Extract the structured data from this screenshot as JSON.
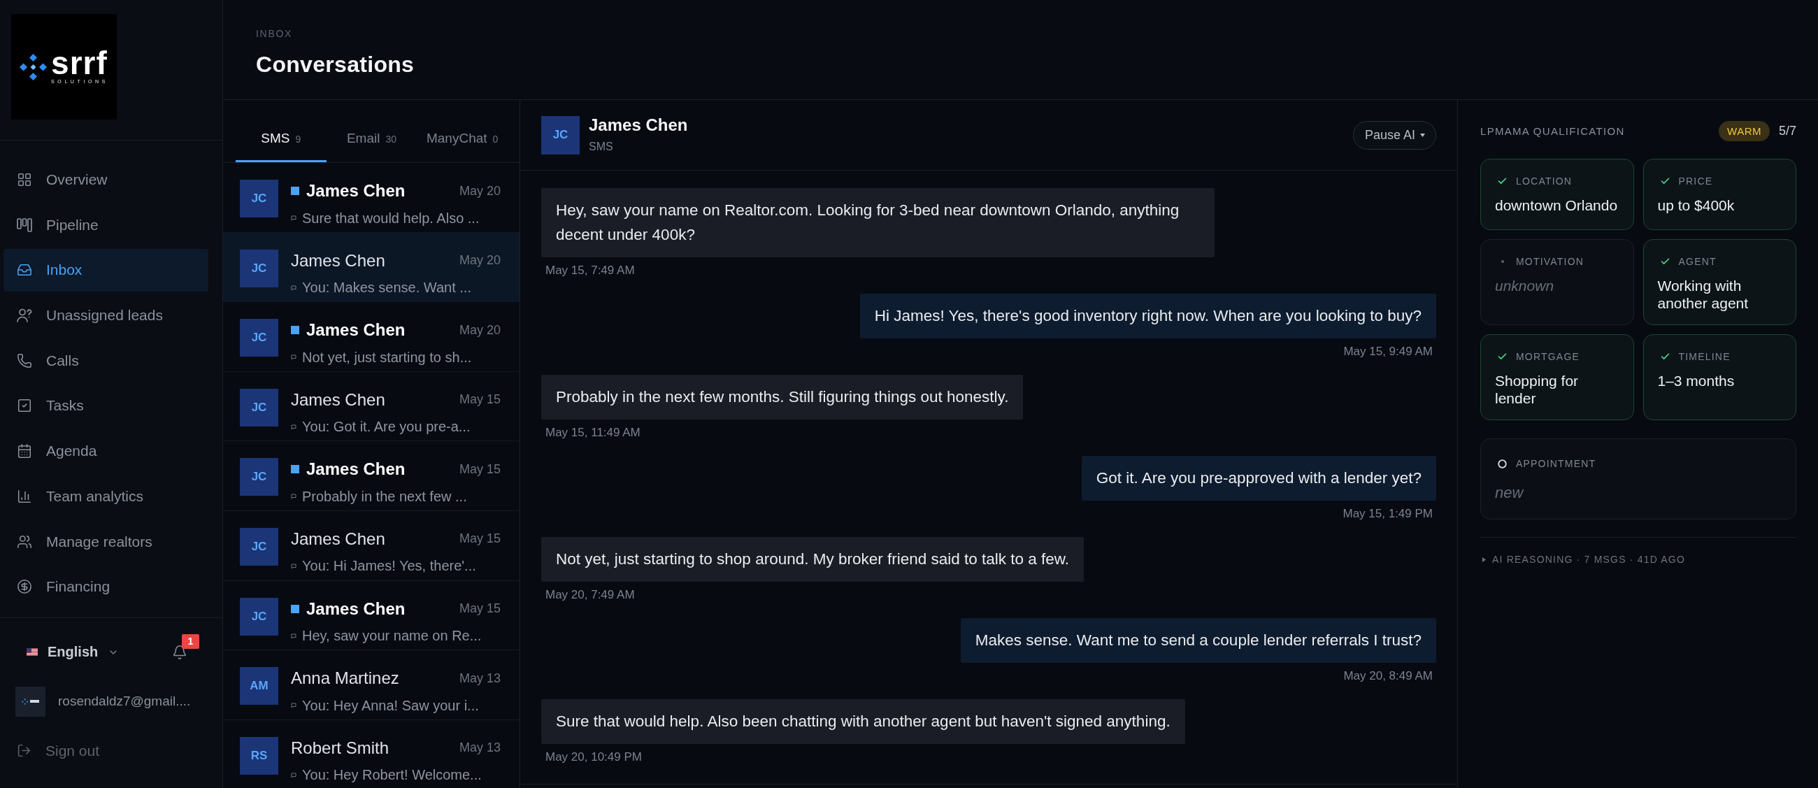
{
  "sidebar": {
    "logo": {
      "wordmark": "srrf",
      "tagline": "SOLUTIONS"
    },
    "nav": [
      {
        "label": "Overview",
        "selected": false
      },
      {
        "label": "Pipeline",
        "selected": false
      },
      {
        "label": "Inbox",
        "selected": true
      },
      {
        "label": "Unassigned leads",
        "selected": false
      },
      {
        "label": "Calls",
        "selected": false
      },
      {
        "label": "Tasks",
        "selected": false
      },
      {
        "label": "Agenda",
        "selected": false
      },
      {
        "label": "Team analytics",
        "selected": false
      },
      {
        "label": "Manage realtors",
        "selected": false
      },
      {
        "label": "Financing",
        "selected": false
      }
    ],
    "language": "English",
    "notification_count": "1",
    "user_email": "rosendaldz7@gmail....",
    "sign_out": "Sign out"
  },
  "header": {
    "eyebrow": "INBOX",
    "title": "Conversations"
  },
  "channel_tabs": [
    {
      "label": "SMS",
      "count": "9",
      "selected": true
    },
    {
      "label": "Email",
      "count": "30",
      "selected": false
    },
    {
      "label": "ManyChat",
      "count": "0",
      "selected": false
    }
  ],
  "conversations": [
    {
      "initials": "JC",
      "name": "James Chen",
      "date": "May 20",
      "preview": "Sure that would help. Also ...",
      "unread": true,
      "selected": false
    },
    {
      "initials": "JC",
      "name": "James Chen",
      "date": "May 20",
      "preview": "You: Makes sense. Want ...",
      "unread": false,
      "selected": true
    },
    {
      "initials": "JC",
      "name": "James Chen",
      "date": "May 20",
      "preview": "Not yet, just starting to sh...",
      "unread": true,
      "selected": false
    },
    {
      "initials": "JC",
      "name": "James Chen",
      "date": "May 15",
      "preview": "You: Got it. Are you pre-a...",
      "unread": false,
      "selected": false
    },
    {
      "initials": "JC",
      "name": "James Chen",
      "date": "May 15",
      "preview": "Probably in the next few ...",
      "unread": true,
      "selected": false
    },
    {
      "initials": "JC",
      "name": "James Chen",
      "date": "May 15",
      "preview": "You: Hi James! Yes, there'...",
      "unread": false,
      "selected": false
    },
    {
      "initials": "JC",
      "name": "James Chen",
      "date": "May 15",
      "preview": "Hey, saw your name on Re...",
      "unread": true,
      "selected": false
    },
    {
      "initials": "AM",
      "name": "Anna Martinez",
      "date": "May 13",
      "preview": "You: Hey Anna! Saw your i...",
      "unread": false,
      "selected": false
    },
    {
      "initials": "RS",
      "name": "Robert Smith",
      "date": "May 13",
      "preview": "You: Hey Robert! Welcome...",
      "unread": false,
      "selected": false
    }
  ],
  "chat": {
    "contact": {
      "initials": "JC",
      "name": "James Chen",
      "channel": "SMS"
    },
    "pause_button": "Pause AI",
    "messages": [
      {
        "kind": "incoming",
        "text": "Hey, saw your name on Realtor.com. Looking for 3-bed near downtown Orlando, anything decent under 400k?",
        "time": "May 15, 7:49 AM"
      },
      {
        "kind": "outgoing",
        "text": "Hi James! Yes, there's good inventory right now. When are you looking to buy?",
        "time": "May 15, 9:49 AM"
      },
      {
        "kind": "incoming",
        "text": "Probably in the next few months. Still figuring things out honestly.",
        "time": "May 15, 11:49 AM"
      },
      {
        "kind": "outgoing",
        "text": "Got it. Are you pre-approved with a lender yet?",
        "time": "May 15, 1:49 PM"
      },
      {
        "kind": "incoming",
        "text": "Not yet, just starting to shop around. My broker friend said to talk to a few.",
        "time": "May 20, 7:49 AM"
      },
      {
        "kind": "outgoing",
        "text": "Makes sense. Want me to send a couple lender referrals I trust?",
        "time": "May 20, 8:49 AM"
      },
      {
        "kind": "incoming",
        "text": "Sure that would help. Also been chatting with another agent but haven't signed anything.",
        "time": "May 20, 10:49 PM"
      }
    ]
  },
  "qualification": {
    "title": "LPMAMA QUALIFICATION",
    "status": "WARM",
    "score": "5/7",
    "criteria": [
      {
        "label": "LOCATION",
        "value": "downtown Orlando",
        "met": true
      },
      {
        "label": "PRICE",
        "value": "up to $400k",
        "met": true
      },
      {
        "label": "MOTIVATION",
        "value": "unknown",
        "met": false
      },
      {
        "label": "AGENT",
        "value": "Working with another agent",
        "met": true
      },
      {
        "label": "MORTGAGE",
        "value": "Shopping for lender",
        "met": true
      },
      {
        "label": "TIMELINE",
        "value": "1–3 months",
        "met": true
      }
    ],
    "appointment": {
      "label": "APPOINTMENT",
      "value": "new",
      "met": false
    },
    "reasoning": {
      "label": "AI REASONING · 7 MSGS · 41D AGO",
      "expanded": false
    }
  }
}
